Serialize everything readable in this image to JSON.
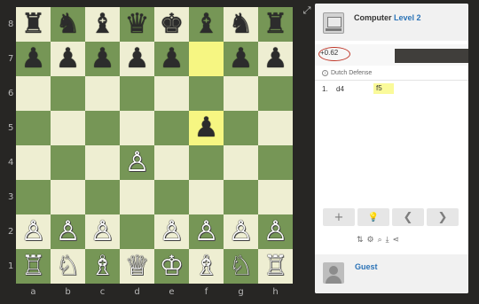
{
  "board": {
    "ranks": [
      "8",
      "7",
      "6",
      "5",
      "4",
      "3",
      "2",
      "1"
    ],
    "files": [
      "a",
      "b",
      "c",
      "d",
      "e",
      "f",
      "g",
      "h"
    ],
    "highlighted_squares": [
      "f7",
      "f5"
    ],
    "pieces": [
      {
        "square": "a8",
        "glyph": "♜",
        "color": "black",
        "name": "black-rook-icon"
      },
      {
        "square": "b8",
        "glyph": "♞",
        "color": "black",
        "name": "black-knight-icon"
      },
      {
        "square": "c8",
        "glyph": "♝",
        "color": "black",
        "name": "black-bishop-icon"
      },
      {
        "square": "d8",
        "glyph": "♛",
        "color": "black",
        "name": "black-queen-icon"
      },
      {
        "square": "e8",
        "glyph": "♚",
        "color": "black",
        "name": "black-king-icon"
      },
      {
        "square": "f8",
        "glyph": "♝",
        "color": "black",
        "name": "black-bishop-icon"
      },
      {
        "square": "g8",
        "glyph": "♞",
        "color": "black",
        "name": "black-knight-icon"
      },
      {
        "square": "h8",
        "glyph": "♜",
        "color": "black",
        "name": "black-rook-icon"
      },
      {
        "square": "a7",
        "glyph": "♟",
        "color": "black",
        "name": "black-pawn-icon"
      },
      {
        "square": "b7",
        "glyph": "♟",
        "color": "black",
        "name": "black-pawn-icon"
      },
      {
        "square": "c7",
        "glyph": "♟",
        "color": "black",
        "name": "black-pawn-icon"
      },
      {
        "square": "d7",
        "glyph": "♟",
        "color": "black",
        "name": "black-pawn-icon"
      },
      {
        "square": "e7",
        "glyph": "♟",
        "color": "black",
        "name": "black-pawn-icon"
      },
      {
        "square": "g7",
        "glyph": "♟",
        "color": "black",
        "name": "black-pawn-icon"
      },
      {
        "square": "h7",
        "glyph": "♟",
        "color": "black",
        "name": "black-pawn-icon"
      },
      {
        "square": "f5",
        "glyph": "♟",
        "color": "black",
        "name": "black-pawn-icon"
      },
      {
        "square": "d4",
        "glyph": "♙",
        "color": "white",
        "name": "white-pawn-icon"
      },
      {
        "square": "a2",
        "glyph": "♙",
        "color": "white",
        "name": "white-pawn-icon"
      },
      {
        "square": "b2",
        "glyph": "♙",
        "color": "white",
        "name": "white-pawn-icon"
      },
      {
        "square": "c2",
        "glyph": "♙",
        "color": "white",
        "name": "white-pawn-icon"
      },
      {
        "square": "e2",
        "glyph": "♙",
        "color": "white",
        "name": "white-pawn-icon"
      },
      {
        "square": "f2",
        "glyph": "♙",
        "color": "white",
        "name": "white-pawn-icon"
      },
      {
        "square": "g2",
        "glyph": "♙",
        "color": "white",
        "name": "white-pawn-icon"
      },
      {
        "square": "h2",
        "glyph": "♙",
        "color": "white",
        "name": "white-pawn-icon"
      },
      {
        "square": "a1",
        "glyph": "♖",
        "color": "white",
        "name": "white-rook-icon"
      },
      {
        "square": "b1",
        "glyph": "♘",
        "color": "white",
        "name": "white-knight-icon"
      },
      {
        "square": "c1",
        "glyph": "♗",
        "color": "white",
        "name": "white-bishop-icon"
      },
      {
        "square": "d1",
        "glyph": "♕",
        "color": "white",
        "name": "white-queen-icon"
      },
      {
        "square": "e1",
        "glyph": "♔",
        "color": "white",
        "name": "white-king-icon"
      },
      {
        "square": "f1",
        "glyph": "♗",
        "color": "white",
        "name": "white-bishop-icon"
      },
      {
        "square": "g1",
        "glyph": "♘",
        "color": "white",
        "name": "white-knight-icon"
      },
      {
        "square": "h1",
        "glyph": "♖",
        "color": "white",
        "name": "white-rook-icon"
      }
    ],
    "colors": {
      "light": "#eeeed2",
      "dark": "#769656",
      "highlight": "#f6f682"
    }
  },
  "opponent": {
    "name": "Computer",
    "level": "Level 2",
    "avatar_icon": "computer-icon"
  },
  "evaluation": {
    "text": "+0.62",
    "annotation_color": "#c0392b",
    "white_share": 0.36
  },
  "opening": {
    "name": "Dutch Defense",
    "icon": "book-icon"
  },
  "moves": [
    {
      "number": "1.",
      "white": "d4",
      "black": "f5"
    }
  ],
  "controls": [
    {
      "name": "add-button",
      "glyph": "+",
      "icon": "plus-icon"
    },
    {
      "name": "hint-button",
      "glyph": "💡",
      "icon": "lightbulb-icon"
    },
    {
      "name": "back-button",
      "glyph": "❮",
      "icon": "chevron-left-icon"
    },
    {
      "name": "forward-button",
      "glyph": "❯",
      "icon": "chevron-right-icon"
    }
  ],
  "tools": [
    {
      "name": "flip-board-button",
      "glyph": "⇅",
      "icon": "flip-icon"
    },
    {
      "name": "settings-button",
      "glyph": "⚙",
      "icon": "gear-icon"
    },
    {
      "name": "analysis-button",
      "glyph": "⌕",
      "icon": "analysis-icon"
    },
    {
      "name": "download-button",
      "glyph": "⤓",
      "icon": "download-icon"
    },
    {
      "name": "share-button",
      "glyph": "⋖",
      "icon": "share-icon"
    }
  ],
  "player": {
    "name": "Guest",
    "avatar_icon": "user-avatar-icon"
  }
}
